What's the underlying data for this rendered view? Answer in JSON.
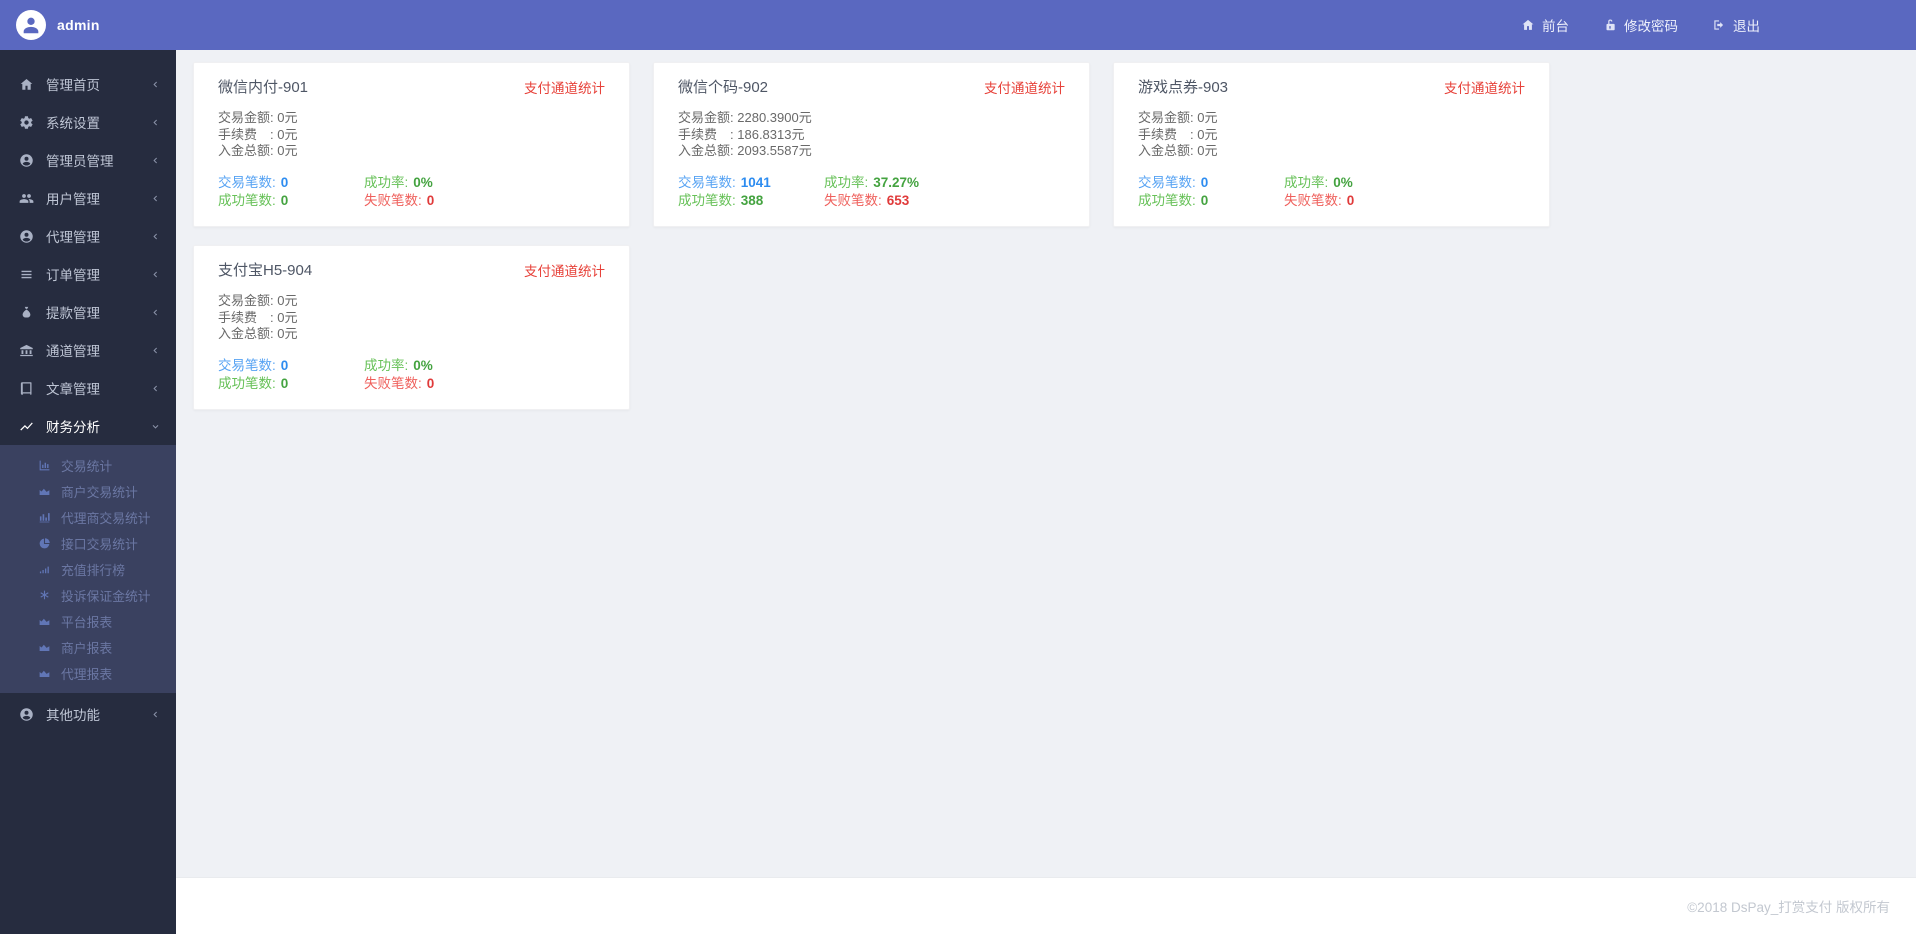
{
  "topbar": {
    "username": "admin",
    "nav": [
      {
        "label": "前台"
      },
      {
        "label": "修改密码"
      },
      {
        "label": "退出"
      }
    ]
  },
  "sidebar": {
    "items": [
      {
        "label": "管理首页"
      },
      {
        "label": "系统设置"
      },
      {
        "label": "管理员管理"
      },
      {
        "label": "用户管理"
      },
      {
        "label": "代理管理"
      },
      {
        "label": "订单管理"
      },
      {
        "label": "提款管理"
      },
      {
        "label": "通道管理"
      },
      {
        "label": "文章管理"
      }
    ],
    "finance": {
      "label": "财务分析",
      "children": [
        {
          "label": "交易统计"
        },
        {
          "label": "商户交易统计"
        },
        {
          "label": "代理商交易统计"
        },
        {
          "label": "接口交易统计"
        },
        {
          "label": "充值排行榜"
        },
        {
          "label": "投诉保证金统计"
        },
        {
          "label": "平台报表"
        },
        {
          "label": "商户报表"
        },
        {
          "label": "代理报表"
        }
      ]
    },
    "other": {
      "label": "其他功能"
    }
  },
  "card_labels": {
    "link": "支付通道统计",
    "amount": "交易金额:",
    "fee": "手续费　:",
    "total": "入金总额:",
    "count": "交易笔数:",
    "rate": "成功率:",
    "success": "成功笔数:",
    "fail": "失败笔数:"
  },
  "cards": [
    {
      "title": "微信内付-901",
      "amount": "0元",
      "fee": "0元",
      "total": "0元",
      "count": "0",
      "rate": "0%",
      "success": "0",
      "fail": "0"
    },
    {
      "title": "微信个码-902",
      "amount": "2280.3900元",
      "fee": "186.8313元",
      "total": "2093.5587元",
      "count": "1041",
      "rate": "37.27%",
      "success": "388",
      "fail": "653"
    },
    {
      "title": "游戏点券-903",
      "amount": "0元",
      "fee": "0元",
      "total": "0元",
      "count": "0",
      "rate": "0%",
      "success": "0",
      "fail": "0"
    },
    {
      "title": "支付宝H5-904",
      "amount": "0元",
      "fee": "0元",
      "total": "0元",
      "count": "0",
      "rate": "0%",
      "success": "0",
      "fail": "0"
    }
  ],
  "footer": {
    "copyright": "©2018 DsPay_打赏支付 版权所有"
  },
  "colors": {
    "topbar": "#5a68c0",
    "sidebar": "#262c3f",
    "submenu_bg": "#3a4160",
    "accent_red": "#e7423a",
    "stat_blue": "#2d8cf0",
    "stat_green": "#44a340",
    "stat_red": "#e03a3a"
  }
}
